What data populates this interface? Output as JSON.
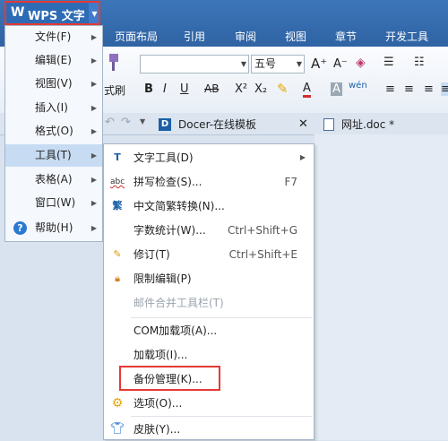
{
  "app": {
    "wps_label": "WPS 文字"
  },
  "ribbon_tabs": [
    "页面布局",
    "引用",
    "审阅",
    "视图",
    "章节",
    "开发工具"
  ],
  "ribbon": {
    "format_brush_label": "式刷",
    "font_size": "五号",
    "bold": "B",
    "italic": "I",
    "underline": "U",
    "strike": "AB",
    "superscript": "X²",
    "subscript": "X₂",
    "font_color": "A",
    "grow_font": "A⁺",
    "shrink_font": "A⁻"
  },
  "doc_tabs": [
    {
      "label": "Docer-在线模板"
    },
    {
      "label": "网址.doc *"
    }
  ],
  "main_menu": [
    {
      "label": "文件(F)"
    },
    {
      "label": "编辑(E)"
    },
    {
      "label": "视图(V)"
    },
    {
      "label": "插入(I)"
    },
    {
      "label": "格式(O)"
    },
    {
      "label": "工具(T)"
    },
    {
      "label": "表格(A)"
    },
    {
      "label": "窗口(W)"
    },
    {
      "label": "帮助(H)"
    }
  ],
  "tools_submenu": [
    {
      "label": "文字工具(D)",
      "shortcut": ""
    },
    {
      "label": "拼写检查(S)...",
      "shortcut": "F7"
    },
    {
      "label": "中文简繁转换(N)...",
      "shortcut": ""
    },
    {
      "label": "字数统计(W)...",
      "shortcut": "Ctrl+Shift+G"
    },
    {
      "label": "修订(T)",
      "shortcut": "Ctrl+Shift+E"
    },
    {
      "label": "限制编辑(P)",
      "shortcut": ""
    },
    {
      "label": "邮件合并工具栏(T)",
      "shortcut": ""
    },
    {
      "label": "COM加载项(A)...",
      "shortcut": ""
    },
    {
      "label": "加载项(I)...",
      "shortcut": ""
    },
    {
      "label": "备份管理(K)...",
      "shortcut": ""
    },
    {
      "label": "选项(O)...",
      "shortcut": ""
    },
    {
      "label": "皮肤(Y)...",
      "shortcut": ""
    }
  ],
  "colors": {
    "accent": "#2e6bb5",
    "highlight": "#e53935"
  }
}
